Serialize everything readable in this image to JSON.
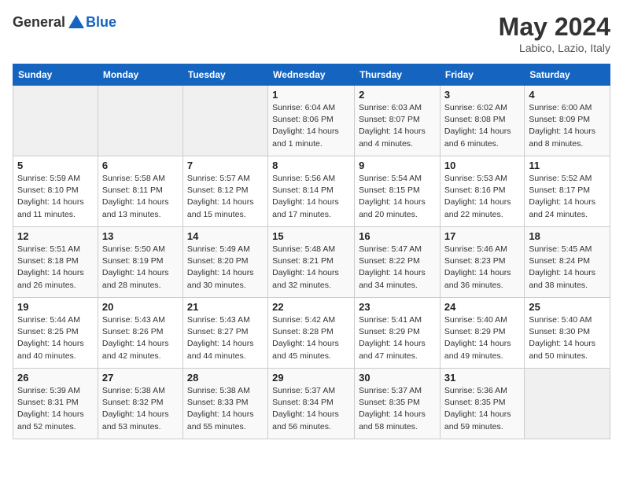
{
  "header": {
    "logo_general": "General",
    "logo_blue": "Blue",
    "month_year": "May 2024",
    "location": "Labico, Lazio, Italy"
  },
  "days_of_week": [
    "Sunday",
    "Monday",
    "Tuesday",
    "Wednesday",
    "Thursday",
    "Friday",
    "Saturday"
  ],
  "weeks": [
    [
      {
        "day": "",
        "detail": ""
      },
      {
        "day": "",
        "detail": ""
      },
      {
        "day": "",
        "detail": ""
      },
      {
        "day": "1",
        "detail": "Sunrise: 6:04 AM\nSunset: 8:06 PM\nDaylight: 14 hours\nand 1 minute."
      },
      {
        "day": "2",
        "detail": "Sunrise: 6:03 AM\nSunset: 8:07 PM\nDaylight: 14 hours\nand 4 minutes."
      },
      {
        "day": "3",
        "detail": "Sunrise: 6:02 AM\nSunset: 8:08 PM\nDaylight: 14 hours\nand 6 minutes."
      },
      {
        "day": "4",
        "detail": "Sunrise: 6:00 AM\nSunset: 8:09 PM\nDaylight: 14 hours\nand 8 minutes."
      }
    ],
    [
      {
        "day": "5",
        "detail": "Sunrise: 5:59 AM\nSunset: 8:10 PM\nDaylight: 14 hours\nand 11 minutes."
      },
      {
        "day": "6",
        "detail": "Sunrise: 5:58 AM\nSunset: 8:11 PM\nDaylight: 14 hours\nand 13 minutes."
      },
      {
        "day": "7",
        "detail": "Sunrise: 5:57 AM\nSunset: 8:12 PM\nDaylight: 14 hours\nand 15 minutes."
      },
      {
        "day": "8",
        "detail": "Sunrise: 5:56 AM\nSunset: 8:14 PM\nDaylight: 14 hours\nand 17 minutes."
      },
      {
        "day": "9",
        "detail": "Sunrise: 5:54 AM\nSunset: 8:15 PM\nDaylight: 14 hours\nand 20 minutes."
      },
      {
        "day": "10",
        "detail": "Sunrise: 5:53 AM\nSunset: 8:16 PM\nDaylight: 14 hours\nand 22 minutes."
      },
      {
        "day": "11",
        "detail": "Sunrise: 5:52 AM\nSunset: 8:17 PM\nDaylight: 14 hours\nand 24 minutes."
      }
    ],
    [
      {
        "day": "12",
        "detail": "Sunrise: 5:51 AM\nSunset: 8:18 PM\nDaylight: 14 hours\nand 26 minutes."
      },
      {
        "day": "13",
        "detail": "Sunrise: 5:50 AM\nSunset: 8:19 PM\nDaylight: 14 hours\nand 28 minutes."
      },
      {
        "day": "14",
        "detail": "Sunrise: 5:49 AM\nSunset: 8:20 PM\nDaylight: 14 hours\nand 30 minutes."
      },
      {
        "day": "15",
        "detail": "Sunrise: 5:48 AM\nSunset: 8:21 PM\nDaylight: 14 hours\nand 32 minutes."
      },
      {
        "day": "16",
        "detail": "Sunrise: 5:47 AM\nSunset: 8:22 PM\nDaylight: 14 hours\nand 34 minutes."
      },
      {
        "day": "17",
        "detail": "Sunrise: 5:46 AM\nSunset: 8:23 PM\nDaylight: 14 hours\nand 36 minutes."
      },
      {
        "day": "18",
        "detail": "Sunrise: 5:45 AM\nSunset: 8:24 PM\nDaylight: 14 hours\nand 38 minutes."
      }
    ],
    [
      {
        "day": "19",
        "detail": "Sunrise: 5:44 AM\nSunset: 8:25 PM\nDaylight: 14 hours\nand 40 minutes."
      },
      {
        "day": "20",
        "detail": "Sunrise: 5:43 AM\nSunset: 8:26 PM\nDaylight: 14 hours\nand 42 minutes."
      },
      {
        "day": "21",
        "detail": "Sunrise: 5:43 AM\nSunset: 8:27 PM\nDaylight: 14 hours\nand 44 minutes."
      },
      {
        "day": "22",
        "detail": "Sunrise: 5:42 AM\nSunset: 8:28 PM\nDaylight: 14 hours\nand 45 minutes."
      },
      {
        "day": "23",
        "detail": "Sunrise: 5:41 AM\nSunset: 8:29 PM\nDaylight: 14 hours\nand 47 minutes."
      },
      {
        "day": "24",
        "detail": "Sunrise: 5:40 AM\nSunset: 8:29 PM\nDaylight: 14 hours\nand 49 minutes."
      },
      {
        "day": "25",
        "detail": "Sunrise: 5:40 AM\nSunset: 8:30 PM\nDaylight: 14 hours\nand 50 minutes."
      }
    ],
    [
      {
        "day": "26",
        "detail": "Sunrise: 5:39 AM\nSunset: 8:31 PM\nDaylight: 14 hours\nand 52 minutes."
      },
      {
        "day": "27",
        "detail": "Sunrise: 5:38 AM\nSunset: 8:32 PM\nDaylight: 14 hours\nand 53 minutes."
      },
      {
        "day": "28",
        "detail": "Sunrise: 5:38 AM\nSunset: 8:33 PM\nDaylight: 14 hours\nand 55 minutes."
      },
      {
        "day": "29",
        "detail": "Sunrise: 5:37 AM\nSunset: 8:34 PM\nDaylight: 14 hours\nand 56 minutes."
      },
      {
        "day": "30",
        "detail": "Sunrise: 5:37 AM\nSunset: 8:35 PM\nDaylight: 14 hours\nand 58 minutes."
      },
      {
        "day": "31",
        "detail": "Sunrise: 5:36 AM\nSunset: 8:35 PM\nDaylight: 14 hours\nand 59 minutes."
      },
      {
        "day": "",
        "detail": ""
      }
    ]
  ]
}
